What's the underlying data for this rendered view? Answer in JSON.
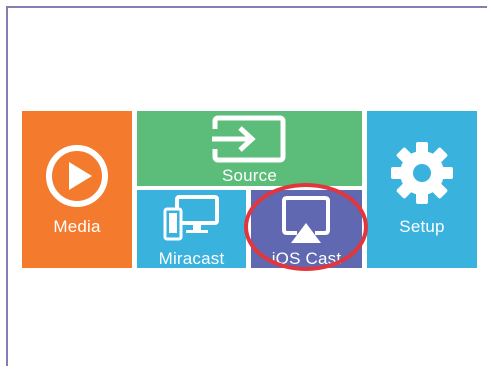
{
  "tiles": {
    "media": {
      "label": "Media",
      "icon": "play-circle-icon",
      "color": "#f47b2e"
    },
    "source": {
      "label": "Source",
      "icon": "input-source-icon",
      "color": "#5bbd79"
    },
    "miracast": {
      "label": "Miracast",
      "icon": "devices-icon",
      "color": "#39b2de"
    },
    "ios_cast": {
      "label": "iOS Cast",
      "icon": "airplay-icon",
      "color": "#5f68b1"
    },
    "setup": {
      "label": "Setup",
      "icon": "gear-icon",
      "color": "#39b2de"
    }
  },
  "highlight": {
    "target": "ios_cast",
    "color": "#e3353c"
  },
  "frame_color": "#8a7ab5"
}
